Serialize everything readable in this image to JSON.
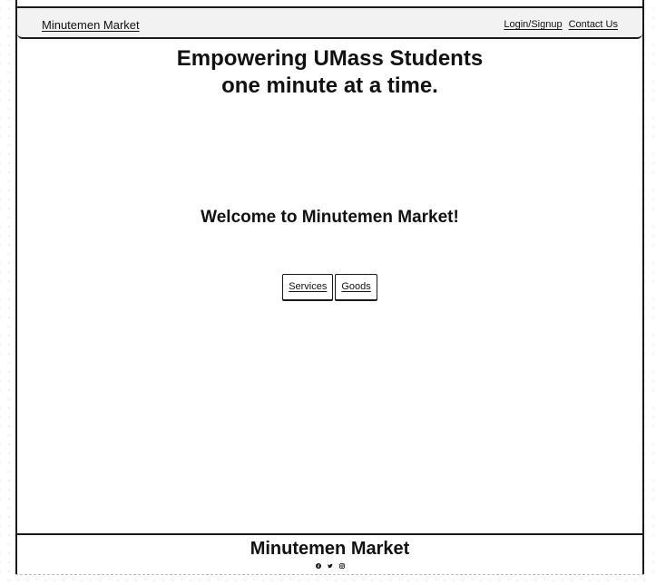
{
  "header": {
    "brand": "Minutemen Market",
    "nav": [
      {
        "label": "Login/Signup"
      },
      {
        "label": "Contact Us"
      }
    ]
  },
  "hero": {
    "line1": "Empowering UMass Students",
    "line2": "one minute at a time."
  },
  "welcome": "Welcome to Minutemen Market!",
  "buttons": {
    "services": "Services",
    "goods": "Goods"
  },
  "footer": {
    "title": "Minutemen Market",
    "social_icons": [
      "facebook-icon",
      "twitter-icon",
      "instagram-icon"
    ]
  }
}
